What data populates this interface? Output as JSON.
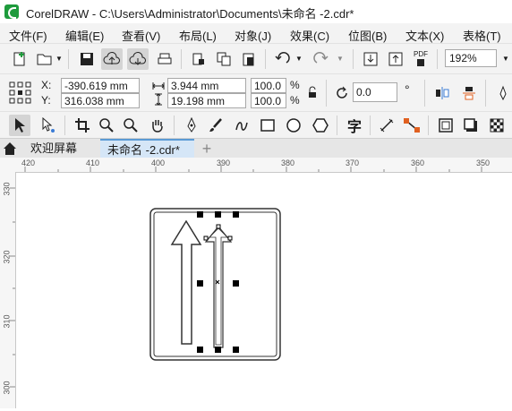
{
  "window": {
    "title": "CorelDRAW - C:\\Users\\Administrator\\Documents\\未命名 -2.cdr*"
  },
  "menu": [
    "文件(F)",
    "编辑(E)",
    "查看(V)",
    "布局(L)",
    "对象(J)",
    "效果(C)",
    "位图(B)",
    "文本(X)",
    "表格(T)"
  ],
  "toolbar": {
    "zoom": "192%",
    "pdf_label": "PDF"
  },
  "properties": {
    "x_label": "X:",
    "y_label": "Y:",
    "x_value": "-390.619 mm",
    "y_value": "316.038 mm",
    "width": "3.944 mm",
    "height": "19.198 mm",
    "scale_w": "100.0",
    "scale_h": "100.0",
    "percent": "%",
    "rotation": "0.0",
    "degree": "°"
  },
  "tabs": {
    "welcome": "欢迎屏幕",
    "document": "未命名 -2.cdr*",
    "add": "+"
  },
  "ruler": {
    "h_ticks": [
      "420",
      "410",
      "400",
      "390",
      "380",
      "370",
      "360",
      "350"
    ],
    "v_ticks": [
      "330",
      "320",
      "310",
      "300"
    ]
  },
  "colors": {
    "selection": "#000000",
    "sign_stroke": "#333333",
    "doc_tab": "#d5e6f7",
    "app_green": "#1e9b3c"
  },
  "icons": [
    "new-document-icon",
    "open-folder-icon",
    "save-icon",
    "cloud-upload-icon",
    "cloud-download-icon",
    "print-icon",
    "import-icon",
    "export-icon",
    "undo-icon",
    "redo-icon",
    "pick-tool-icon",
    "shape-tool-icon",
    "crop-tool-icon",
    "zoom-tool-icon",
    "pan-tool-icon",
    "pen-tool-icon",
    "brush-tool-icon",
    "rectangle-tool-icon",
    "ellipse-tool-icon",
    "polygon-tool-icon",
    "text-tool-icon",
    "lock-icon"
  ]
}
